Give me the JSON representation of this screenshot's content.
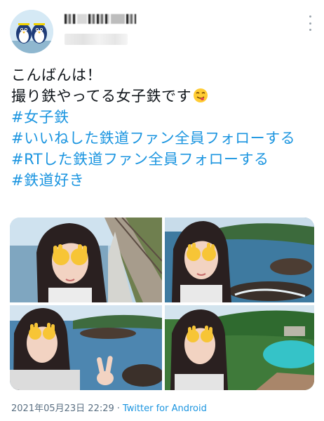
{
  "profile": {
    "avatar_icon": "penguin-avatar-icon",
    "display_name_blurred": true,
    "handle_blurred": true
  },
  "tweet": {
    "lines": [
      "こんばんは！",
      "撮り鉄やってる女子鉄です"
    ],
    "emoji": "smiling-face-tongue-icon",
    "hashtags": [
      "#女子鉄",
      "#いいねした鉄道ファン全員フォローする",
      "#RTした鉄道ファン全員フォローする",
      "#鉄道好き"
    ],
    "photos_count_visible": 4
  },
  "meta": {
    "timestamp": "2021年05月23日 22:29",
    "separator": "·",
    "source": "Twitter for Android"
  },
  "colors": {
    "link": "#1b95e0",
    "text": "#0f1419",
    "meta": "#5b7083"
  },
  "icons": {
    "more": "more-vertical-icon"
  }
}
